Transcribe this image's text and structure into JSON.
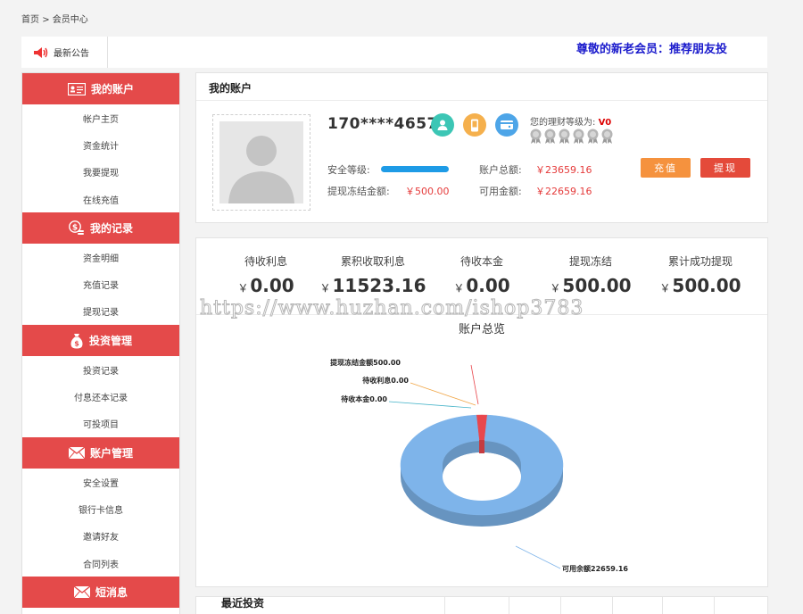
{
  "breadcrumb": {
    "home": "首页",
    "sep": ">",
    "current": "会员中心"
  },
  "notice": {
    "label": "最新公告",
    "text": "尊敬的新老会员：推荐朋友投"
  },
  "sidebar": {
    "sections": [
      {
        "title": "我的账户",
        "icon": "id-card-icon",
        "items": [
          "帐户主页",
          "资金统计",
          "我要提现",
          "在线充值"
        ]
      },
      {
        "title": "我的记录",
        "icon": "coins-icon",
        "items": [
          "资金明细",
          "充值记录",
          "提现记录"
        ]
      },
      {
        "title": "投资管理",
        "icon": "money-bag-icon",
        "items": [
          "投资记录",
          "付息还本记录",
          "可投项目"
        ]
      },
      {
        "title": "账户管理",
        "icon": "envelope-icon",
        "items": [
          "安全设置",
          "银行卡信息",
          "邀请好友",
          "合同列表"
        ]
      },
      {
        "title": "短消息",
        "icon": "envelope-icon",
        "items": []
      }
    ]
  },
  "account": {
    "title": "我的账户",
    "phone": "170****4657",
    "level_label": "您的理财等级为:",
    "level_value": "V0",
    "security_label": "安全等级:",
    "security_level": 1.0,
    "total_label": "账户总额:",
    "total_value": "￥23659.16",
    "frozen_label": "提现冻结金额:",
    "frozen_value": "￥500.00",
    "available_label": "可用金额:",
    "available_value": "￥22659.16",
    "recharge_button": "充值",
    "withdraw_button": "提现",
    "colors": {
      "recharge": "#f5923e",
      "withdraw": "#e44a3a",
      "accent": "#e44a4a"
    }
  },
  "stats": [
    {
      "label": "待收利息",
      "currency": "￥",
      "value": "0.00"
    },
    {
      "label": "累积收取利息",
      "currency": "￥",
      "value": "11523.16"
    },
    {
      "label": "待收本金",
      "currency": "￥",
      "value": "0.00"
    },
    {
      "label": "提现冻结",
      "currency": "￥",
      "value": "500.00"
    },
    {
      "label": "累计成功提现",
      "currency": "￥",
      "value": "500.00"
    }
  ],
  "watermark": "https://www.huzhan.com/ishop3783",
  "chart_data": {
    "type": "pie",
    "title": "账户总览",
    "slices": [
      {
        "label": "可用余额",
        "value": 22659.16,
        "color": "#7eb4ea",
        "label_text": "可用余额22659.16"
      },
      {
        "label": "提现冻结金额",
        "value": 500.0,
        "color": "#e8474d",
        "label_text": "提现冻结金额500.00"
      },
      {
        "label": "待收利息",
        "value": 0.0,
        "color": "#f1a646",
        "label_text": "待收利息0.00"
      },
      {
        "label": "待收本金",
        "value": 0.0,
        "color": "#45b3c8",
        "label_text": "待收本金0.00"
      }
    ]
  },
  "recent": {
    "title": "最近投资"
  }
}
